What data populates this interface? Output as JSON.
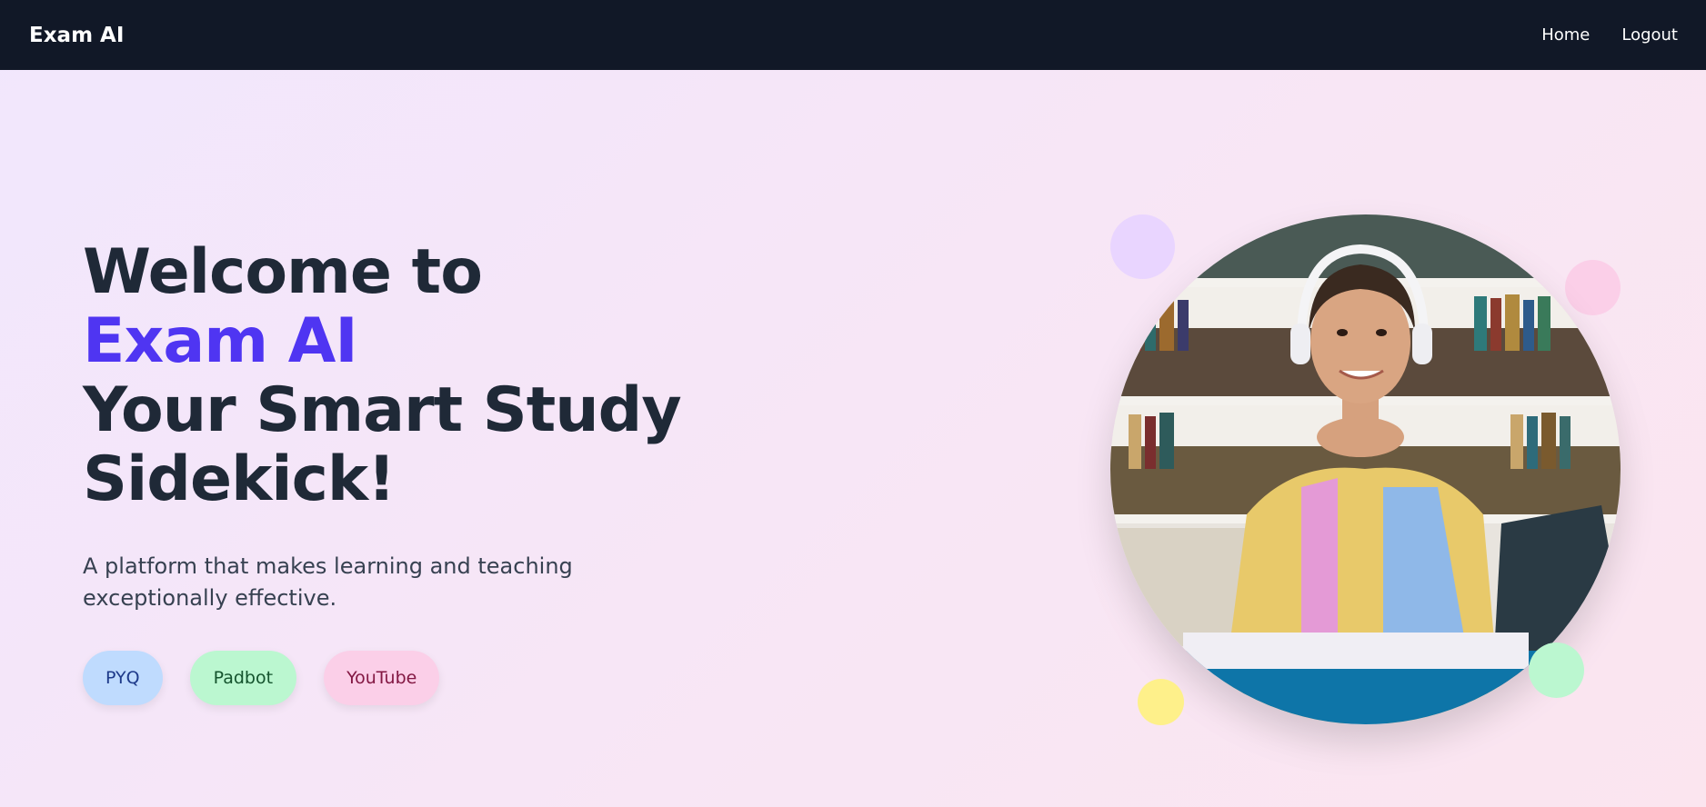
{
  "navbar": {
    "brand": "Exam AI",
    "links": [
      {
        "label": "Home"
      },
      {
        "label": "Logout"
      }
    ]
  },
  "hero": {
    "line1": "Welcome to",
    "line2": "Exam AI",
    "line3": "Your Smart Study",
    "line4": "Sidekick!",
    "subtitle": "A platform that makes learning and teaching exceptionally effective.",
    "buttons": [
      {
        "label": "PYQ"
      },
      {
        "label": "Padbot"
      },
      {
        "label": "YouTube"
      }
    ]
  },
  "colors": {
    "navbar_bg": "#111827",
    "accent": "#4f35f2",
    "heading": "#1f2937",
    "pyq_bg": "#bfdbfe",
    "padbot_bg": "#bbf7d0",
    "youtube_bg": "#fbcfe8"
  },
  "image": {
    "alt": "student-with-headphones-photo"
  }
}
